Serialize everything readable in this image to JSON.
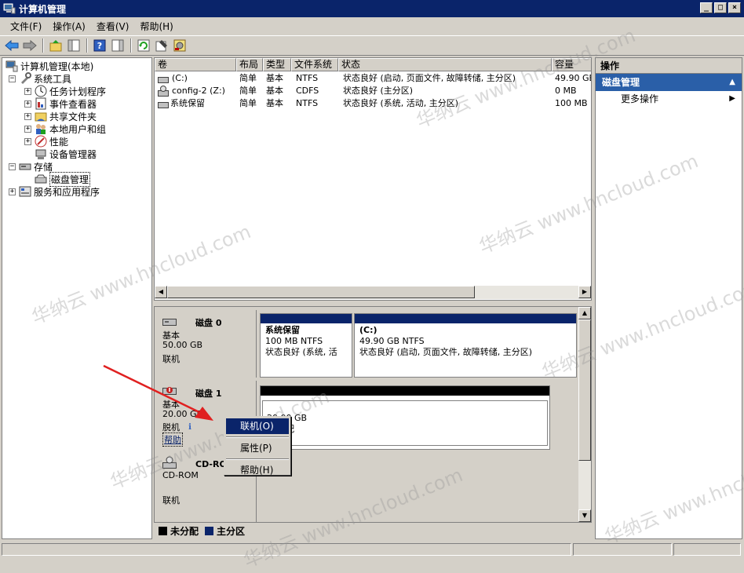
{
  "window": {
    "title": "计算机管理"
  },
  "menu": [
    "文件(F)",
    "操作(A)",
    "查看(V)",
    "帮助(H)"
  ],
  "tree": {
    "root": "计算机管理(本地)",
    "system_tools": "系统工具",
    "task_scheduler": "任务计划程序",
    "event_viewer": "事件查看器",
    "shared_folders": "共享文件夹",
    "local_users": "本地用户和组",
    "performance": "性能",
    "device_manager": "设备管理器",
    "storage": "存储",
    "disk_management": "磁盘管理",
    "services": "服务和应用程序"
  },
  "volume_table": {
    "headers": [
      "卷",
      "布局",
      "类型",
      "文件系统",
      "状态",
      "容量"
    ],
    "rows": [
      [
        "(C:)",
        "简单",
        "基本",
        "NTFS",
        "状态良好 (启动, 页面文件, 故障转储, 主分区)",
        "49.90 GB"
      ],
      [
        "config-2 (Z:)",
        "简单",
        "基本",
        "CDFS",
        "状态良好 (主分区)",
        "0 MB"
      ],
      [
        "系统保留",
        "简单",
        "基本",
        "NTFS",
        "状态良好 (系统, 活动, 主分区)",
        "100 MB"
      ]
    ]
  },
  "disks": {
    "disk0": {
      "name": "磁盘 0",
      "type": "基本",
      "size": "50.00 GB",
      "status": "联机",
      "p1": {
        "name": "系统保留",
        "size": "100 MB NTFS",
        "status": "状态良好 (系统, 活"
      },
      "p2": {
        "name": "(C:)",
        "size": "49.90 GB NTFS",
        "status": "状态良好 (启动, 页面文件, 故障转储, 主分区)"
      }
    },
    "disk1": {
      "name": "磁盘 1",
      "type": "基本",
      "size": "20.00 GB",
      "status": "脱机",
      "help": "帮助",
      "p1": {
        "size": "20.00 GB",
        "extra": "配"
      }
    },
    "cdrom": {
      "name": "CD-ROM 0",
      "type": "CD-ROM",
      "status": "联机"
    }
  },
  "legend": {
    "unallocated": "未分配",
    "primary": "主分区"
  },
  "actions": {
    "header": "操作",
    "section": "磁盘管理",
    "more": "更多操作"
  },
  "context_menu": {
    "online": "联机(O)",
    "properties": "属性(P)",
    "help": "帮助(H)"
  },
  "watermark": "华纳云 www.hncloud.com",
  "colors": {
    "titlebar": "#0a246a",
    "primary_partition": "#0a246a",
    "unallocated": "#000000",
    "action_section": "#2a5fa8",
    "arrow": "#e02020"
  }
}
